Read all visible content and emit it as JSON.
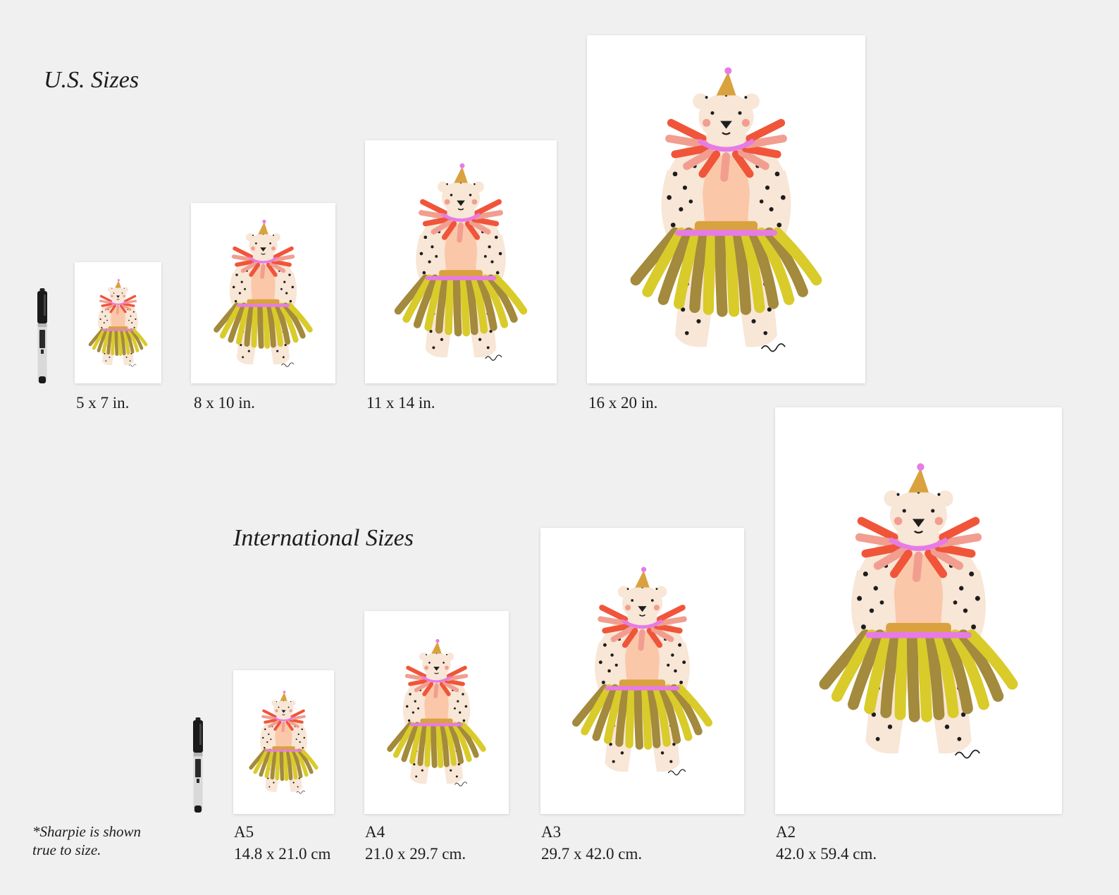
{
  "us_section": {
    "heading": "U.S. Sizes",
    "sizes": [
      {
        "label": "5 x 7 in."
      },
      {
        "label": "8 x 10 in."
      },
      {
        "label": "11 x 14 in."
      },
      {
        "label": "16 x 20 in."
      }
    ]
  },
  "international_section": {
    "heading": "International Sizes",
    "sizes": [
      {
        "name": "A5",
        "dims": "14.8 x 21.0 cm"
      },
      {
        "name": "A4",
        "dims": "21.0 x 29.7 cm."
      },
      {
        "name": "A3",
        "dims": "29.7 x 42.0 cm."
      },
      {
        "name": "A2",
        "dims": "42.0 x 59.4 cm."
      }
    ]
  },
  "note": {
    "line1": "*Sharpie is shown",
    "line2": "true to size."
  },
  "artwork": {
    "subject": "bear-with-party-hat-ruff-and-grass-skirt",
    "colors": {
      "background": "#eff0ef",
      "paper": "#ffffff",
      "body": "#f8e6d6",
      "belly": "#fbc7a9",
      "ruff_red": "#f0553a",
      "ruff_pink": "#f19e90",
      "hat_gold": "#d9a23e",
      "pink": "#e77be6",
      "skirt_olive": "#a38a3c",
      "skirt_yellow": "#d9cb2a",
      "spots": "#1d1d1d"
    }
  }
}
